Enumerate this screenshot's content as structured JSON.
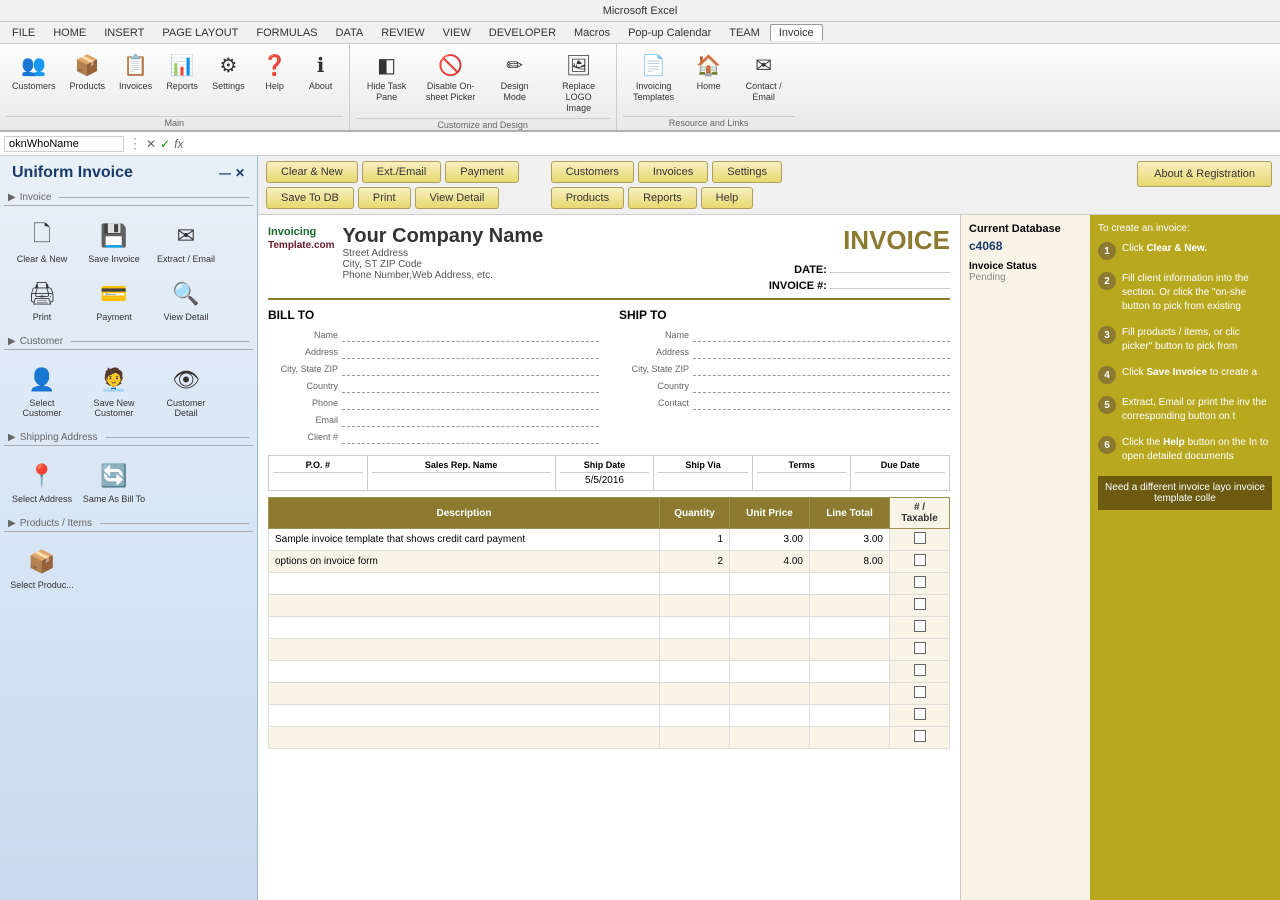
{
  "titleBar": {
    "title": "Microsoft Excel"
  },
  "menuBar": {
    "items": [
      "FILE",
      "HOME",
      "INSERT",
      "PAGE LAYOUT",
      "FORMULAS",
      "DATA",
      "REVIEW",
      "VIEW",
      "DEVELOPER",
      "Macros",
      "Pop-up Calendar",
      "TEAM",
      "Invoice"
    ]
  },
  "ribbon": {
    "groups": [
      {
        "label": "Main",
        "buttons": [
          {
            "id": "customers",
            "icon": "👥",
            "label": "Customers"
          },
          {
            "id": "products",
            "icon": "📦",
            "label": "Products"
          },
          {
            "id": "invoices",
            "icon": "📋",
            "label": "Invoices"
          },
          {
            "id": "reports",
            "icon": "📊",
            "label": "Reports"
          },
          {
            "id": "settings",
            "icon": "⚙",
            "label": "Settings"
          },
          {
            "id": "help",
            "icon": "❓",
            "label": "Help"
          },
          {
            "id": "about",
            "icon": "ℹ",
            "label": "About"
          }
        ]
      },
      {
        "label": "Customize and Design",
        "buttons": [
          {
            "id": "hide-task-pane",
            "icon": "◧",
            "label": "Hide Task Pane"
          },
          {
            "id": "disable-on-sheet-picker",
            "icon": "🚫",
            "label": "Disable On-sheet Picker"
          },
          {
            "id": "design-mode",
            "icon": "✏",
            "label": "Design Mode"
          },
          {
            "id": "replace-logo",
            "icon": "🖼",
            "label": "Replace LOGO Image"
          }
        ]
      },
      {
        "label": "Resource and Links",
        "buttons": [
          {
            "id": "invoicing-templates",
            "icon": "📄",
            "label": "Invoicing Templates"
          },
          {
            "id": "home",
            "icon": "🏠",
            "label": "Home"
          },
          {
            "id": "contact-email",
            "icon": "✉",
            "label": "Contact / Email"
          }
        ]
      }
    ]
  },
  "formulaBar": {
    "nameBox": "oknWhoName",
    "cancelIcon": "✕",
    "confirmIcon": "✓",
    "functionIcon": "fx"
  },
  "sidebar": {
    "title": "Uniform Invoice",
    "sections": [
      {
        "id": "invoice",
        "label": "Invoice",
        "items": [
          {
            "id": "clear-new",
            "icon": "🗋",
            "label": "Clear & New"
          },
          {
            "id": "save-invoice",
            "icon": "💾",
            "label": "Save Invoice"
          },
          {
            "id": "extract-email",
            "icon": "✉",
            "label": "Extract / Email"
          },
          {
            "id": "print",
            "icon": "🖨",
            "label": "Print"
          },
          {
            "id": "payment",
            "icon": "💳",
            "label": "Payment"
          },
          {
            "id": "view-detail",
            "icon": "🔍",
            "label": "View Detail"
          }
        ]
      },
      {
        "id": "customer",
        "label": "Customer",
        "items": [
          {
            "id": "select-customer",
            "icon": "👤",
            "label": "Select Customer"
          },
          {
            "id": "save-new-customer",
            "icon": "👤+",
            "label": "Save New Customer"
          },
          {
            "id": "customer-detail",
            "icon": "👁",
            "label": "Customer Detail"
          }
        ]
      },
      {
        "id": "shipping",
        "label": "Shipping Address",
        "items": [
          {
            "id": "select-address",
            "icon": "📍",
            "label": "Select Address"
          },
          {
            "id": "same-as-bill",
            "icon": "🔄",
            "label": "Same As Bill To"
          }
        ]
      },
      {
        "id": "products",
        "label": "Products / Items",
        "items": [
          {
            "id": "select-product",
            "icon": "📦",
            "label": "Select Produc..."
          }
        ]
      }
    ]
  },
  "toolbar": {
    "row1": [
      {
        "id": "clear-new",
        "label": "Clear & New"
      },
      {
        "id": "ext-email",
        "label": "Ext./Email"
      },
      {
        "id": "payment",
        "label": "Payment"
      }
    ],
    "row2": [
      {
        "id": "save-to-db",
        "label": "Save To DB"
      },
      {
        "id": "print",
        "label": "Print"
      },
      {
        "id": "view-detail",
        "label": "View Detail"
      }
    ],
    "rightRow1": [
      {
        "id": "customers",
        "label": "Customers"
      },
      {
        "id": "invoices",
        "label": "Invoices"
      },
      {
        "id": "settings",
        "label": "Settings"
      }
    ],
    "rightRow2": [
      {
        "id": "products",
        "label": "Products"
      },
      {
        "id": "reports",
        "label": "Reports"
      },
      {
        "id": "help",
        "label": "Help"
      }
    ],
    "aboutBtn": "About & Registration"
  },
  "invoice": {
    "companyName": "Your Company Name",
    "title": "INVOICE",
    "logoLine1": "Invoicing",
    "logoLine2": "Template.com",
    "address": "Street Address",
    "cityStateZip": "City, ST  ZIP Code",
    "phone": "Phone Number,Web Address, etc.",
    "dateLabel": "DATE:",
    "dateValue": "",
    "invoiceNumLabel": "INVOICE #:",
    "invoiceNumValue": "",
    "billToTitle": "BILL TO",
    "shipToTitle": "SHIP TO",
    "billFields": [
      {
        "label": "Name",
        "id": "bill-name"
      },
      {
        "label": "Address",
        "id": "bill-address"
      },
      {
        "label": "City, State ZIP",
        "id": "bill-city"
      },
      {
        "label": "Country",
        "id": "bill-country"
      },
      {
        "label": "Phone",
        "id": "bill-phone"
      },
      {
        "label": "Email",
        "id": "bill-email"
      },
      {
        "label": "Client #",
        "id": "bill-client"
      }
    ],
    "shipFields": [
      {
        "label": "Name",
        "id": "ship-name"
      },
      {
        "label": "Address",
        "id": "ship-address"
      },
      {
        "label": "City, State ZIP",
        "id": "ship-city"
      },
      {
        "label": "Country",
        "id": "ship-country"
      },
      {
        "label": "Contact",
        "id": "ship-contact"
      }
    ],
    "poColumns": [
      "P.O. #",
      "Sales Rep. Name",
      "Ship Date",
      "Ship Via",
      "Terms",
      "Due Date"
    ],
    "poValues": [
      "",
      "",
      "5/5/2016",
      "",
      "",
      ""
    ],
    "lineColumns": [
      "Description",
      "Quantity",
      "Unit Price",
      "Line Total"
    ],
    "lineItems": [
      {
        "desc": "Sample invoice template that shows credit card payment",
        "qty": "1",
        "price": "3.00",
        "total": "3.00"
      },
      {
        "desc": "options on invoice form",
        "qty": "2",
        "price": "4.00",
        "total": "8.00"
      }
    ],
    "taxableHeader": "# / Taxable"
  },
  "infoPanel": {
    "currentDb": "Current Database",
    "dbValue": "c4068",
    "invoiceStatus": "Invoice Status",
    "statusValue": "Pending",
    "toCreateLabel": "To create an invoice:",
    "steps": [
      {
        "num": "1",
        "text": "Click Clear & New."
      },
      {
        "num": "2",
        "text": "Fill client information into the section. Or click the \"on-she button to pick from existing"
      },
      {
        "num": "3",
        "text": "Fill products / items, or clic picker\" button to pick from"
      },
      {
        "num": "4",
        "text": "Click Save Invoice to create a"
      },
      {
        "num": "5",
        "text": "Extract, Email or print the inv the corresponding button on t"
      },
      {
        "num": "6",
        "text": "Click the Help button on the In to open detailed documents"
      }
    ],
    "bottomNote": "Need a different invoice layo invoice template colle"
  }
}
